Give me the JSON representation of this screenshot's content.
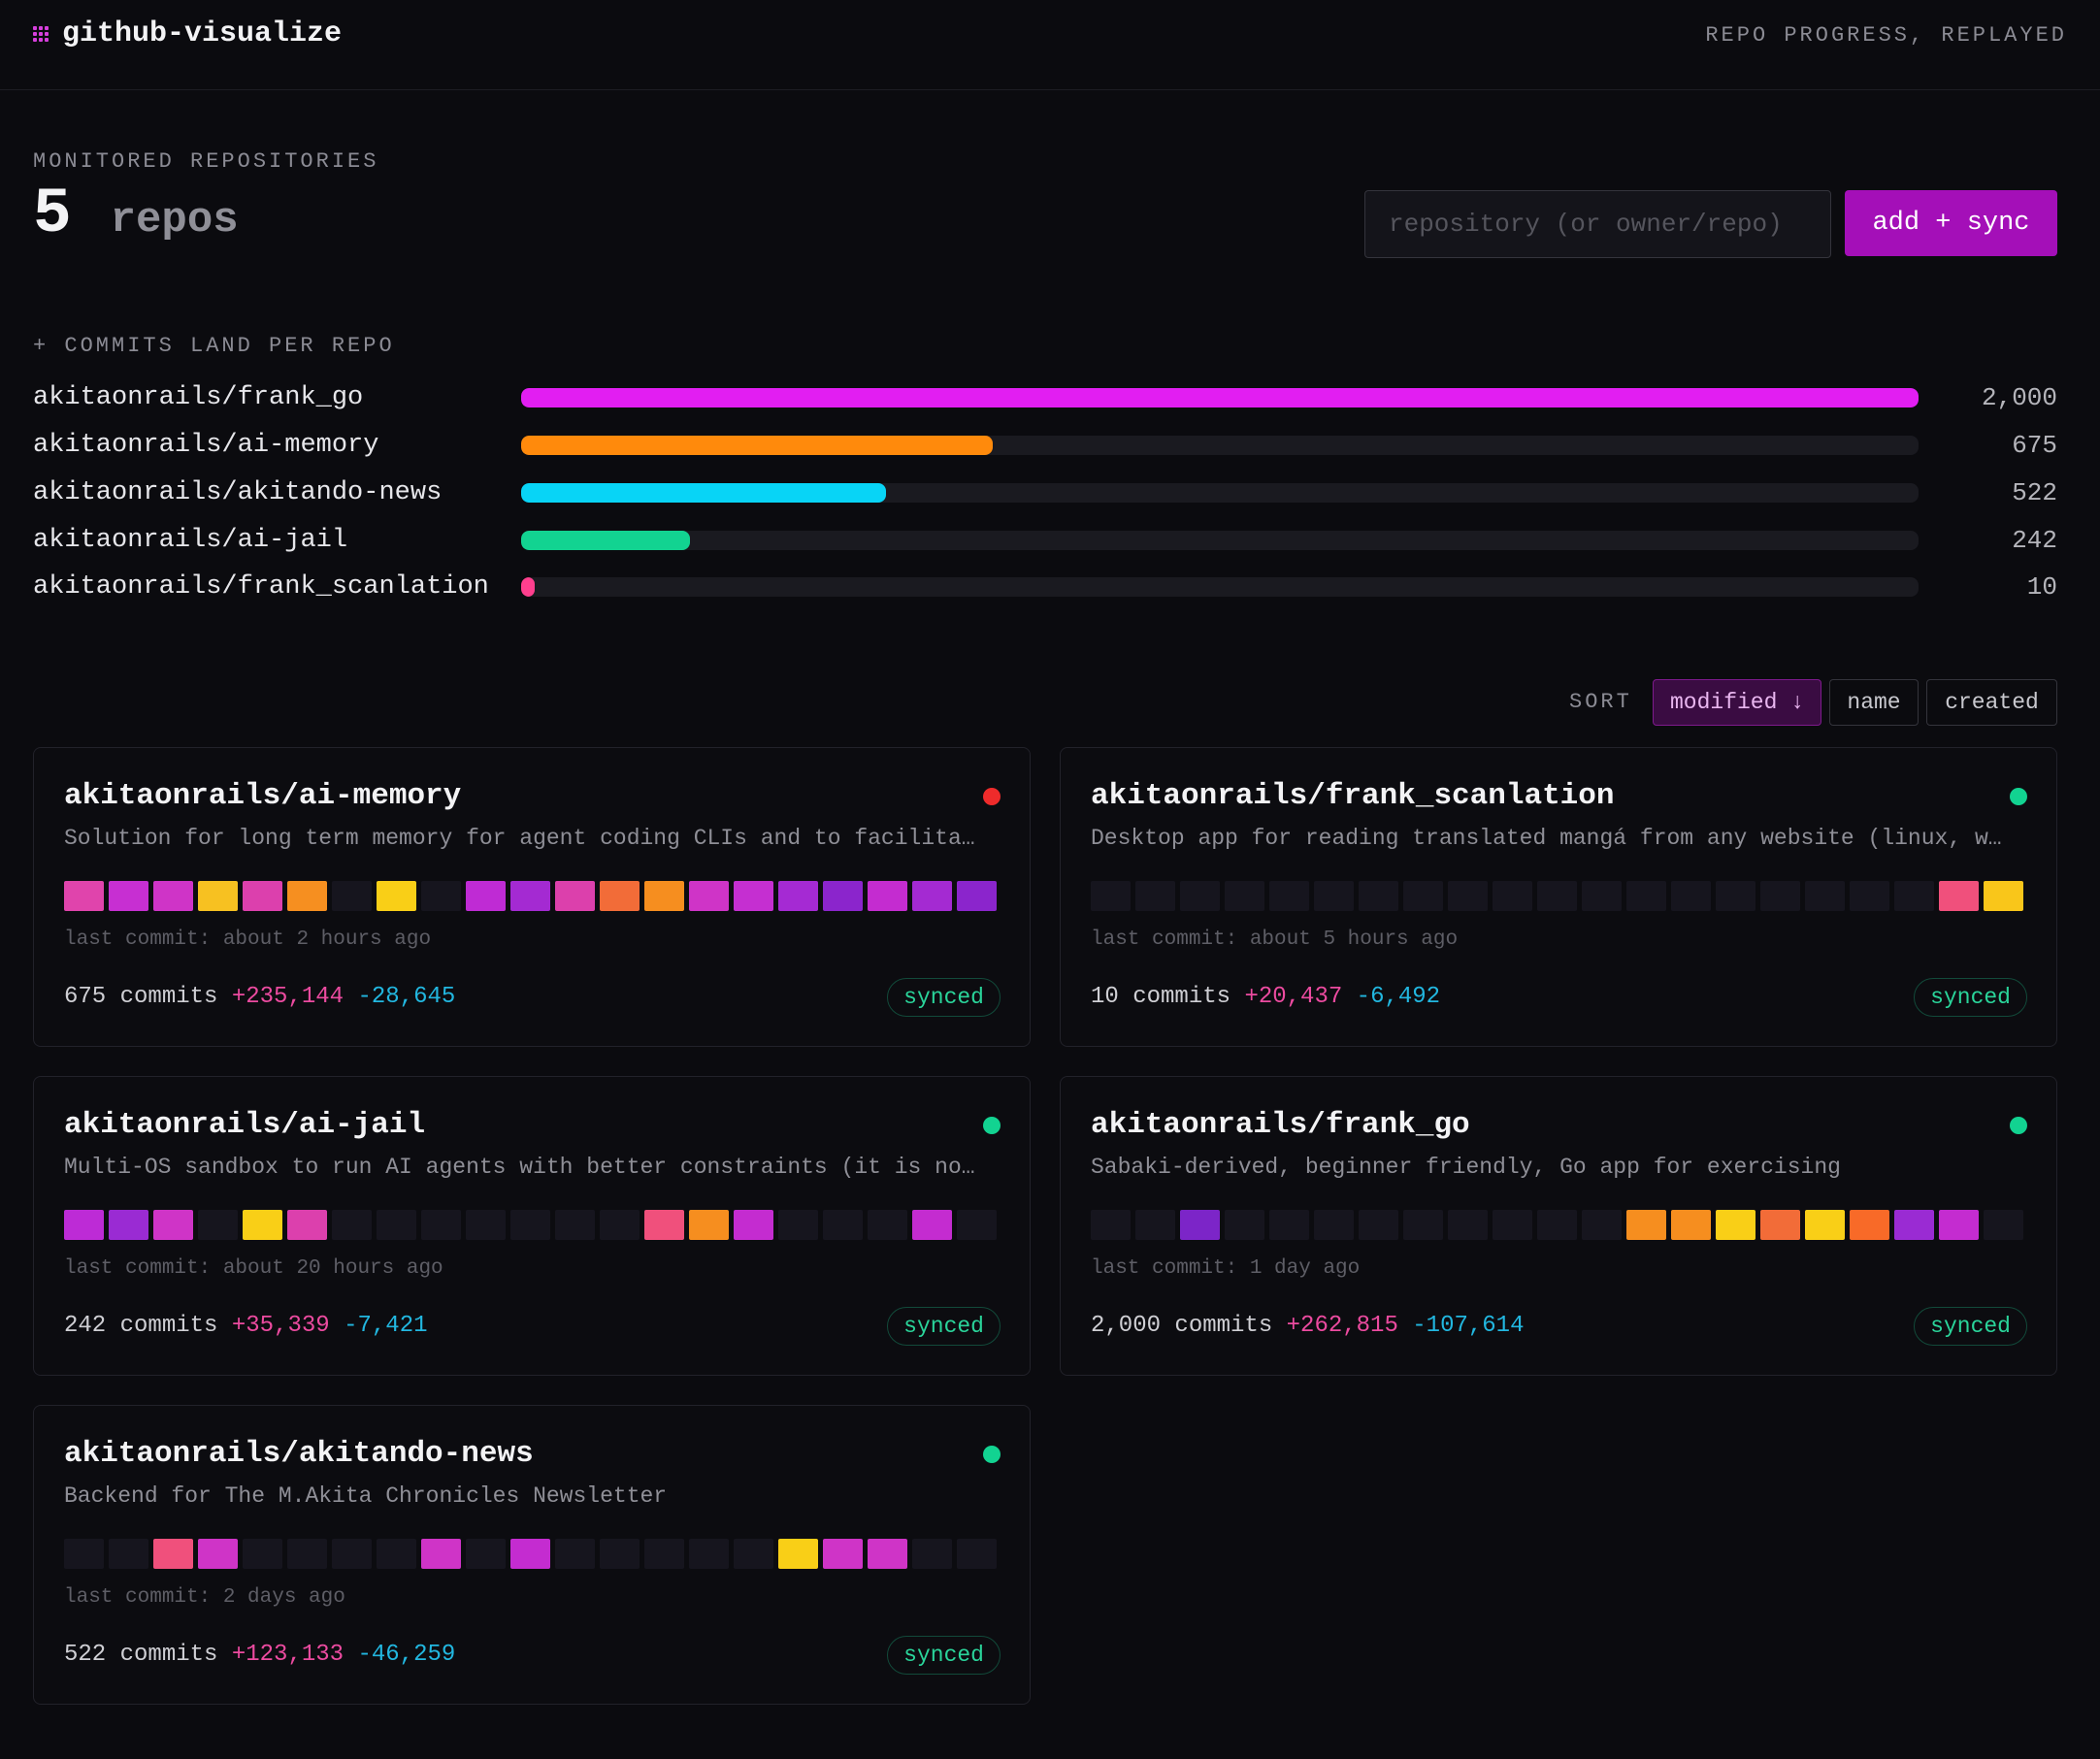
{
  "header": {
    "app_name": "github-visualize",
    "tagline": "REPO PROGRESS, REPLAYED"
  },
  "summary": {
    "label": "MONITORED REPOSITORIES",
    "count": "5",
    "unit": "repos",
    "input_placeholder": "repository (or owner/repo)",
    "add_button": "add + sync"
  },
  "land": {
    "label": "+ COMMITS LAND PER REPO",
    "bars": [
      {
        "name": "akitaonrails/frank_go",
        "value": 2000,
        "value_label": "2,000",
        "color": "#e21ef2"
      },
      {
        "name": "akitaonrails/ai-memory",
        "value": 675,
        "value_label": "675",
        "color": "#ff8a0c"
      },
      {
        "name": "akitaonrails/akitando-news",
        "value": 522,
        "value_label": "522",
        "color": "#08d4f6"
      },
      {
        "name": "akitaonrails/ai-jail",
        "value": 242,
        "value_label": "242",
        "color": "#12d391"
      },
      {
        "name": "akitaonrails/frank_scanlation",
        "value": 10,
        "value_label": "10",
        "color": "#ff3f8e"
      }
    ]
  },
  "sort": {
    "label": "SORT",
    "options": [
      "modified ↓",
      "name",
      "created"
    ],
    "active": "modified ↓"
  },
  "cards": [
    {
      "title": "akitaonrails/ai-memory",
      "status_color": "#ef2b2b",
      "description": "Solution for long term memory for agent coding CLIs and to facilitate",
      "cells": [
        "#e044ac",
        "#c72fd2",
        "#cf34c7",
        "#f7c121",
        "#dc40ad",
        "#f68f20",
        "#16151e",
        "#f9cf17",
        "#16151e",
        "#bf2bd4",
        "#a42ad2",
        "#dc40ac",
        "#f26c38",
        "#f68e1f",
        "#cf34c7",
        "#c52fd1",
        "#a52ad3",
        "#8b25cc",
        "#c42cd0",
        "#a42ad2",
        "#8b25cc"
      ],
      "last_commit": "last commit: about 2 hours ago",
      "commits": "675 commits",
      "additions": "+235,144",
      "deletions": "-28,645",
      "badge": "synced"
    },
    {
      "title": "akitaonrails/frank_scanlation",
      "status_color": "#12d391",
      "description": "Desktop app for reading translated mangá from any website (linux, windows, macos)",
      "cells": [
        "#16151e",
        "#16151e",
        "#16151e",
        "#16151e",
        "#16151e",
        "#16151e",
        "#16151e",
        "#16151e",
        "#16151e",
        "#16151e",
        "#16151e",
        "#16151e",
        "#16151e",
        "#16151e",
        "#16151e",
        "#16151e",
        "#16151e",
        "#16151e",
        "#16151e",
        "#f0507c",
        "#f9c61a"
      ],
      "last_commit": "last commit: about 5 hours ago",
      "commits": "10 commits",
      "additions": "+20,437",
      "deletions": "-6,492",
      "badge": "synced"
    },
    {
      "title": "akitaonrails/ai-jail",
      "status_color": "#12d391",
      "description": "Multi-OS sandbox to run AI agents with better constraints (it is not a VM)",
      "cells": [
        "#bd2bd6",
        "#9a2bd3",
        "#cf34c7",
        "#16151e",
        "#f9cf17",
        "#dc40ad",
        "#16151e",
        "#16151e",
        "#16151e",
        "#16151e",
        "#16151e",
        "#16151e",
        "#16151e",
        "#f0507c",
        "#f68e1f",
        "#c42cd0",
        "#16151e",
        "#16151e",
        "#16151e",
        "#c42cd0",
        "#16151e"
      ],
      "last_commit": "last commit: about 20 hours ago",
      "commits": "242 commits",
      "additions": "+35,339",
      "deletions": "-7,421",
      "badge": "synced"
    },
    {
      "title": "akitaonrails/frank_go",
      "status_color": "#12d391",
      "description": "Sabaki-derived, beginner friendly, Go app for exercising",
      "cells": [
        "#16151e",
        "#16151e",
        "#7c25c8",
        "#16151e",
        "#16151e",
        "#16151e",
        "#16151e",
        "#16151e",
        "#16151e",
        "#16151e",
        "#16151e",
        "#16151e",
        "#f68e1f",
        "#f68e1f",
        "#f9cf17",
        "#f26c38",
        "#f9cf17",
        "#f86a28",
        "#9a2bd3",
        "#c42cd0",
        "#16151e"
      ],
      "last_commit": "last commit: 1 day ago",
      "commits": "2,000 commits",
      "additions": "+262,815",
      "deletions": "-107,614",
      "badge": "synced"
    },
    {
      "title": "akitaonrails/akitando-news",
      "status_color": "#12d391",
      "description": "Backend for The M.Akita Chronicles Newsletter",
      "cells": [
        "#16151e",
        "#16151e",
        "#f0507c",
        "#cf34c7",
        "#16151e",
        "#16151e",
        "#16151e",
        "#16151e",
        "#cf34c7",
        "#16151e",
        "#c42cd0",
        "#16151e",
        "#16151e",
        "#16151e",
        "#16151e",
        "#16151e",
        "#f9cf17",
        "#cf34c7",
        "#cf34c7",
        "#16151e",
        "#16151e"
      ],
      "last_commit": "last commit: 2 days ago",
      "commits": "522 commits",
      "additions": "+123,133",
      "deletions": "-46,259",
      "badge": "synced"
    }
  ]
}
